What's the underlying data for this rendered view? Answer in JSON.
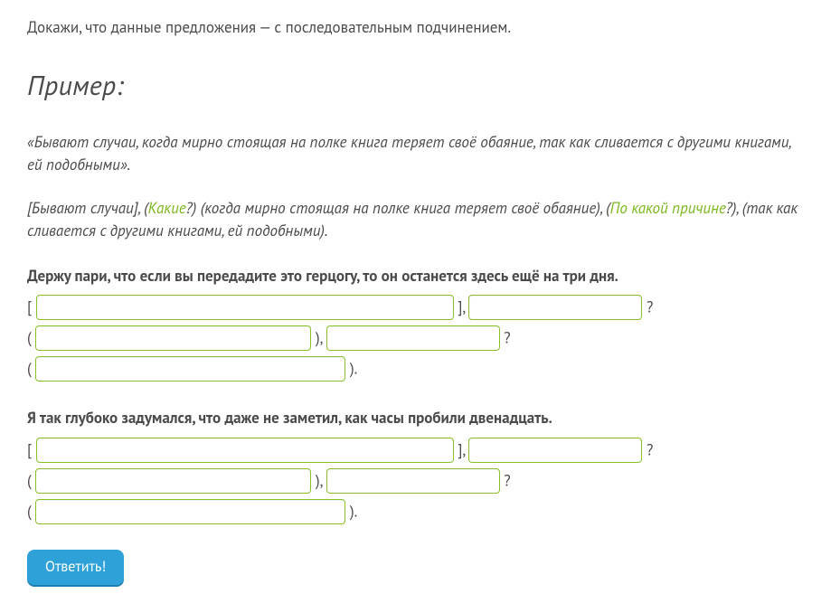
{
  "instruction": "Докажи, что данные предложения — с последовательным подчинением.",
  "example": {
    "heading": "Пример:",
    "text": "«Бывают случаи, когда мирно стоящая на полке книга теряет своё обаяние, так как сливается с другими книгами, ей подобными».",
    "analysis_parts": {
      "p1": "[Бывают случаи], (",
      "q1": "Какие",
      "p2": "?) (когда мирно стоящая на полке книга теряет своё обаяние), (",
      "q2": "По какой причине",
      "p3": "?), (так как сливается с другими книгами, ей подобными)."
    }
  },
  "tasks": [
    {
      "sentence": "Держу пари, что если вы передадите это герцогу, то он останется здесь ещё на три дня.",
      "lines": [
        {
          "open": "[ ",
          "w1": "w462",
          "mid1": " ], ",
          "w2": "w192",
          "tail": " ?"
        },
        {
          "open": "( ",
          "w1": "w305",
          "mid1": " ), ",
          "w2": "w192b",
          "tail": " ?"
        },
        {
          "open": "( ",
          "w1": "w343",
          "tail": " )."
        }
      ]
    },
    {
      "sentence": "Я так глубоко задумался, что даже не заметил, как часы пробили двенадцать.",
      "lines": [
        {
          "open": "[ ",
          "w1": "w462",
          "mid1": " ], ",
          "w2": "w192",
          "tail": " ?"
        },
        {
          "open": "( ",
          "w1": "w305",
          "mid1": " ), ",
          "w2": "w192b",
          "tail": " ?"
        },
        {
          "open": "( ",
          "w1": "w343",
          "tail": " )."
        }
      ]
    }
  ],
  "submit_label": "Ответить!"
}
